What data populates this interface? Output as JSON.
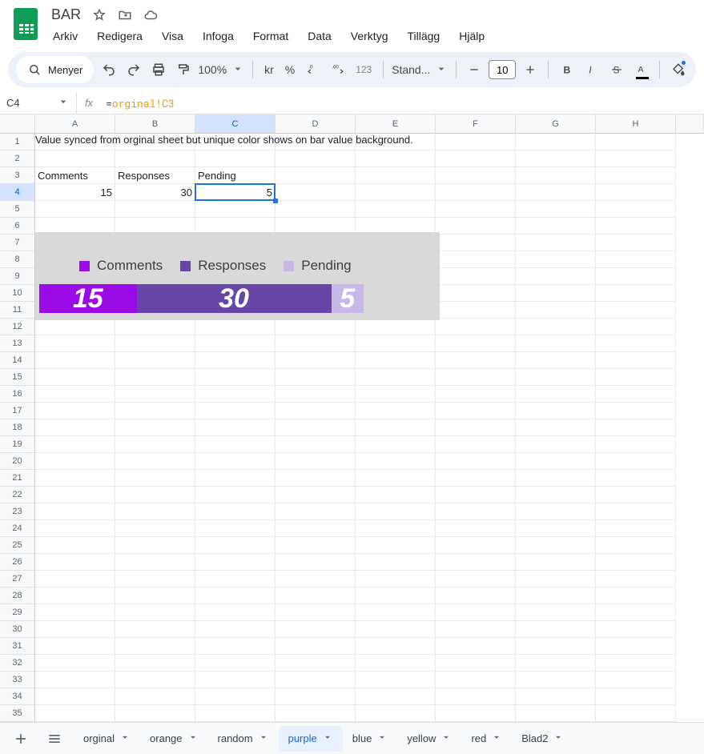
{
  "doc": {
    "title": "BAR"
  },
  "menus": [
    "Arkiv",
    "Redigera",
    "Visa",
    "Infoga",
    "Format",
    "Data",
    "Verktyg",
    "Tillägg",
    "Hjälp"
  ],
  "toolbar": {
    "menus_label": "Menyer",
    "zoom": "100%",
    "currency": "kr",
    "percent": "%",
    "dec_less": ".0",
    "dec_more": ".00",
    "num_fmt": "123",
    "font": "Stand...",
    "font_size": "10",
    "fill_accent": "#1a73e8"
  },
  "cell_ref": "C4",
  "formula": {
    "eq": "=",
    "expr": "orginal!C3"
  },
  "columns": [
    "A",
    "B",
    "C",
    "D",
    "E",
    "F",
    "G",
    "H"
  ],
  "selected_col": 2,
  "selected_row": 3,
  "rows": 35,
  "cells": {
    "A1": "Value synced from orginal sheet but unique color shows on bar value background.",
    "A3": "Comments",
    "B3": "Responses",
    "C3": "Pending",
    "A4": "15",
    "B4": "30",
    "C4": "5"
  },
  "chart_data": {
    "type": "bar",
    "layout": "stacked-horizontal-100",
    "series": [
      {
        "name": "Comments",
        "value": 15,
        "color": "#9a0be8"
      },
      {
        "name": "Responses",
        "value": 30,
        "color": "#6746a7"
      },
      {
        "name": "Pending",
        "value": 5,
        "color": "#c8b8e8"
      }
    ],
    "legend_position": "top"
  },
  "tabs": {
    "list": [
      "orginal",
      "orange",
      "random",
      "purple",
      "blue",
      "yellow",
      "red",
      "Blad2"
    ],
    "active": "purple"
  }
}
